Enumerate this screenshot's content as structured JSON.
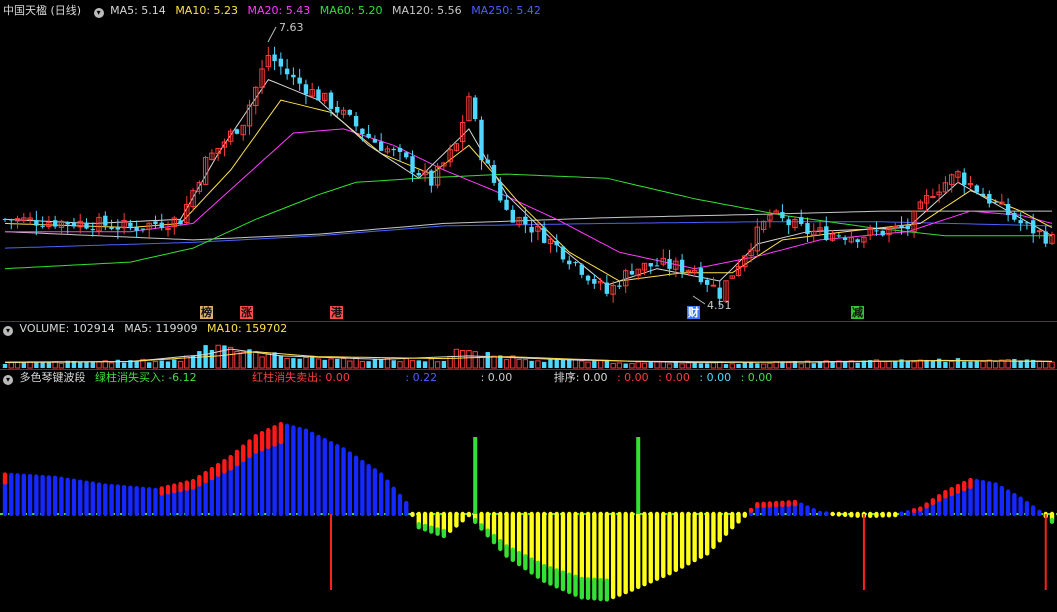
{
  "price_panel": {
    "title": "中国天楹 (日线)",
    "ma_labels": [
      {
        "text": "MA5: 5.14",
        "color": "#d8d8d8"
      },
      {
        "text": "MA10: 5.23",
        "color": "#ffe14a"
      },
      {
        "text": "MA20: 5.43",
        "color": "#ff3cff"
      },
      {
        "text": "MA60: 5.20",
        "color": "#33e033"
      },
      {
        "text": "MA120: 5.56",
        "color": "#c8c8c8"
      },
      {
        "text": "MA250: 5.42",
        "color": "#4c60ff"
      }
    ],
    "high_label": "7.63",
    "low_label": "4.51",
    "tags": [
      {
        "text": "榜",
        "bg": "#e0b070"
      },
      {
        "text": "涨",
        "bg": "#ff4c4c"
      },
      {
        "text": "港",
        "bg": "#ff4c4c"
      },
      {
        "text": "财",
        "bg": "#3c78ff"
      },
      {
        "text": "减",
        "bg": "#33c433"
      }
    ]
  },
  "volume_panel": {
    "labels": [
      {
        "text": "VOLUME: 102914",
        "color": "#d8d8d8"
      },
      {
        "text": "MA5: 119909",
        "color": "#d8d8d8"
      },
      {
        "text": "MA10: 159702",
        "color": "#ffe14a"
      }
    ]
  },
  "indicator_panel": {
    "name": "多色琴键波段",
    "labels": [
      {
        "text": "绿柱消失买入: -6.12",
        "color": "#3ee03e"
      },
      {
        "text": "红柱消失卖出: 0.00",
        "color": "#ff3b3b"
      },
      {
        "text": ": 0.22",
        "color": "#4c60ff"
      },
      {
        "text": ": 0.00",
        "color": "#c8c8c8"
      },
      {
        "text": "排序: 0.00",
        "color": "#d8d8d8"
      },
      {
        "text": ": 0.00",
        "color": "#ff3b3b"
      },
      {
        "text": ": 0.00",
        "color": "#ff3b3b"
      },
      {
        "text": ": 0.00",
        "color": "#4fd8ff"
      },
      {
        "text": ": 0.00",
        "color": "#3ee03e"
      }
    ]
  },
  "chart_data": {
    "type": "candlestick",
    "price_ylim": [
      4.3,
      7.9
    ],
    "price_range": {
      "high": 7.63,
      "low": 4.51
    },
    "candle_count": 168,
    "colors": {
      "up": "#ff3b3b",
      "down": "#4fd8ff",
      "ma5": "#d8d8d8",
      "ma10": "#ffe14a",
      "ma20": "#ff3cff",
      "ma60": "#33e033",
      "ma120": "#c8c8c8",
      "ma250": "#4c60ff"
    },
    "price_path": [
      [
        0,
        5.5
      ],
      [
        14,
        5.45
      ],
      [
        20,
        5.4
      ],
      [
        28,
        5.5
      ],
      [
        32,
        6.2
      ],
      [
        38,
        6.7
      ],
      [
        42,
        7.5
      ],
      [
        46,
        7.2
      ],
      [
        52,
        6.9
      ],
      [
        58,
        6.5
      ],
      [
        64,
        6.2
      ],
      [
        68,
        5.95
      ],
      [
        72,
        6.4
      ],
      [
        74,
        7.0
      ],
      [
        76,
        6.3
      ],
      [
        80,
        5.6
      ],
      [
        86,
        5.3
      ],
      [
        92,
        4.9
      ],
      [
        96,
        4.6
      ],
      [
        100,
        4.9
      ],
      [
        104,
        4.95
      ],
      [
        110,
        4.9
      ],
      [
        114,
        4.6
      ],
      [
        118,
        5.1
      ],
      [
        122,
        5.55
      ],
      [
        128,
        5.35
      ],
      [
        136,
        5.3
      ],
      [
        144,
        5.4
      ],
      [
        148,
        5.85
      ],
      [
        152,
        6.05
      ],
      [
        156,
        5.8
      ],
      [
        162,
        5.45
      ],
      [
        167,
        5.25
      ]
    ],
    "ma_paths": {
      "ma5": [
        [
          0,
          5.5
        ],
        [
          14,
          5.45
        ],
        [
          28,
          5.5
        ],
        [
          34,
          6.3
        ],
        [
          42,
          7.2
        ],
        [
          50,
          6.95
        ],
        [
          58,
          6.4
        ],
        [
          66,
          6.0
        ],
        [
          74,
          6.6
        ],
        [
          80,
          5.8
        ],
        [
          88,
          5.2
        ],
        [
          96,
          4.7
        ],
        [
          104,
          4.9
        ],
        [
          114,
          4.75
        ],
        [
          120,
          5.2
        ],
        [
          128,
          5.35
        ],
        [
          144,
          5.4
        ],
        [
          152,
          5.95
        ],
        [
          160,
          5.6
        ],
        [
          167,
          5.3
        ]
      ],
      "ma10": [
        [
          0,
          5.45
        ],
        [
          20,
          5.4
        ],
        [
          28,
          5.45
        ],
        [
          36,
          6.1
        ],
        [
          44,
          6.95
        ],
        [
          52,
          6.8
        ],
        [
          60,
          6.3
        ],
        [
          68,
          6.05
        ],
        [
          74,
          6.4
        ],
        [
          82,
          5.7
        ],
        [
          90,
          5.1
        ],
        [
          98,
          4.75
        ],
        [
          108,
          4.85
        ],
        [
          116,
          4.85
        ],
        [
          124,
          5.25
        ],
        [
          134,
          5.35
        ],
        [
          146,
          5.45
        ],
        [
          154,
          5.85
        ],
        [
          162,
          5.6
        ],
        [
          167,
          5.4
        ]
      ],
      "ma20": [
        [
          0,
          5.35
        ],
        [
          20,
          5.35
        ],
        [
          30,
          5.45
        ],
        [
          38,
          6.0
        ],
        [
          46,
          6.55
        ],
        [
          54,
          6.6
        ],
        [
          62,
          6.4
        ],
        [
          70,
          6.1
        ],
        [
          78,
          5.85
        ],
        [
          88,
          5.5
        ],
        [
          98,
          5.1
        ],
        [
          110,
          4.9
        ],
        [
          120,
          5.05
        ],
        [
          130,
          5.25
        ],
        [
          144,
          5.35
        ],
        [
          154,
          5.6
        ],
        [
          162,
          5.55
        ],
        [
          167,
          5.45
        ]
      ],
      "ma60": [
        [
          0,
          4.9
        ],
        [
          20,
          4.98
        ],
        [
          30,
          5.15
        ],
        [
          40,
          5.5
        ],
        [
          50,
          5.8
        ],
        [
          56,
          5.95
        ],
        [
          66,
          6.0
        ],
        [
          80,
          6.05
        ],
        [
          96,
          6.0
        ],
        [
          110,
          5.75
        ],
        [
          124,
          5.55
        ],
        [
          138,
          5.4
        ],
        [
          150,
          5.3
        ],
        [
          167,
          5.3
        ]
      ],
      "ma120": [
        [
          0,
          5.35
        ],
        [
          30,
          5.25
        ],
        [
          50,
          5.32
        ],
        [
          70,
          5.45
        ],
        [
          96,
          5.52
        ],
        [
          120,
          5.56
        ],
        [
          140,
          5.6
        ],
        [
          167,
          5.6
        ]
      ],
      "ma250": [
        [
          0,
          5.15
        ],
        [
          30,
          5.22
        ],
        [
          50,
          5.3
        ],
        [
          70,
          5.42
        ],
        [
          96,
          5.45
        ],
        [
          120,
          5.47
        ],
        [
          140,
          5.47
        ],
        [
          167,
          5.42
        ]
      ]
    },
    "volume_levels": [
      [
        0,
        0.18
      ],
      [
        10,
        0.22
      ],
      [
        28,
        0.28
      ],
      [
        32,
        0.8
      ],
      [
        34,
        0.95
      ],
      [
        38,
        0.6
      ],
      [
        42,
        0.5
      ],
      [
        50,
        0.35
      ],
      [
        60,
        0.3
      ],
      [
        70,
        0.28
      ],
      [
        72,
        0.7
      ],
      [
        74,
        0.55
      ],
      [
        78,
        0.45
      ],
      [
        86,
        0.3
      ],
      [
        100,
        0.2
      ],
      [
        112,
        0.18
      ],
      [
        124,
        0.2
      ],
      [
        140,
        0.25
      ],
      [
        150,
        0.3
      ],
      [
        160,
        0.28
      ],
      [
        167,
        0.22
      ]
    ],
    "volume_ma5": [
      [
        0,
        0.2
      ],
      [
        20,
        0.24
      ],
      [
        32,
        0.5
      ],
      [
        36,
        0.7
      ],
      [
        44,
        0.45
      ],
      [
        60,
        0.32
      ],
      [
        74,
        0.45
      ],
      [
        90,
        0.3
      ],
      [
        110,
        0.2
      ],
      [
        130,
        0.22
      ],
      [
        150,
        0.28
      ],
      [
        167,
        0.24
      ]
    ],
    "volume_ma10": [
      [
        0,
        0.22
      ],
      [
        20,
        0.24
      ],
      [
        34,
        0.45
      ],
      [
        40,
        0.6
      ],
      [
        50,
        0.42
      ],
      [
        70,
        0.35
      ],
      [
        80,
        0.42
      ],
      [
        100,
        0.25
      ],
      [
        120,
        0.22
      ],
      [
        150,
        0.27
      ],
      [
        167,
        0.25
      ]
    ],
    "osc": [
      [
        0,
        3.6
      ],
      [
        8,
        3.3
      ],
      [
        16,
        2.6
      ],
      [
        24,
        2.2
      ],
      [
        30,
        3.0
      ],
      [
        36,
        5.2
      ],
      [
        40,
        7.1
      ],
      [
        44,
        8.2
      ],
      [
        48,
        7.6
      ],
      [
        54,
        5.9
      ],
      [
        60,
        3.6
      ],
      [
        64,
        1.0
      ],
      [
        66,
        -1.2
      ],
      [
        70,
        -2.0
      ],
      [
        74,
        -0.1
      ],
      [
        80,
        -3.8
      ],
      [
        86,
        -6.1
      ],
      [
        92,
        -7.6
      ],
      [
        96,
        -7.8
      ],
      [
        100,
        -6.9
      ],
      [
        106,
        -5.4
      ],
      [
        112,
        -3.6
      ],
      [
        116,
        -1.2
      ],
      [
        120,
        0.9
      ],
      [
        126,
        1.1
      ],
      [
        130,
        0.1
      ],
      [
        136,
        -0.2
      ],
      [
        142,
        -0.1
      ],
      [
        146,
        0.5
      ],
      [
        150,
        2.0
      ],
      [
        154,
        3.1
      ],
      [
        158,
        2.7
      ],
      [
        162,
        1.4
      ],
      [
        165,
        0.2
      ],
      [
        167,
        -0.7
      ]
    ],
    "osc_ylim": [
      -8.5,
      11.5
    ],
    "buy_signals": [
      75,
      101
    ],
    "sell_signals": [
      52,
      137,
      166
    ]
  }
}
